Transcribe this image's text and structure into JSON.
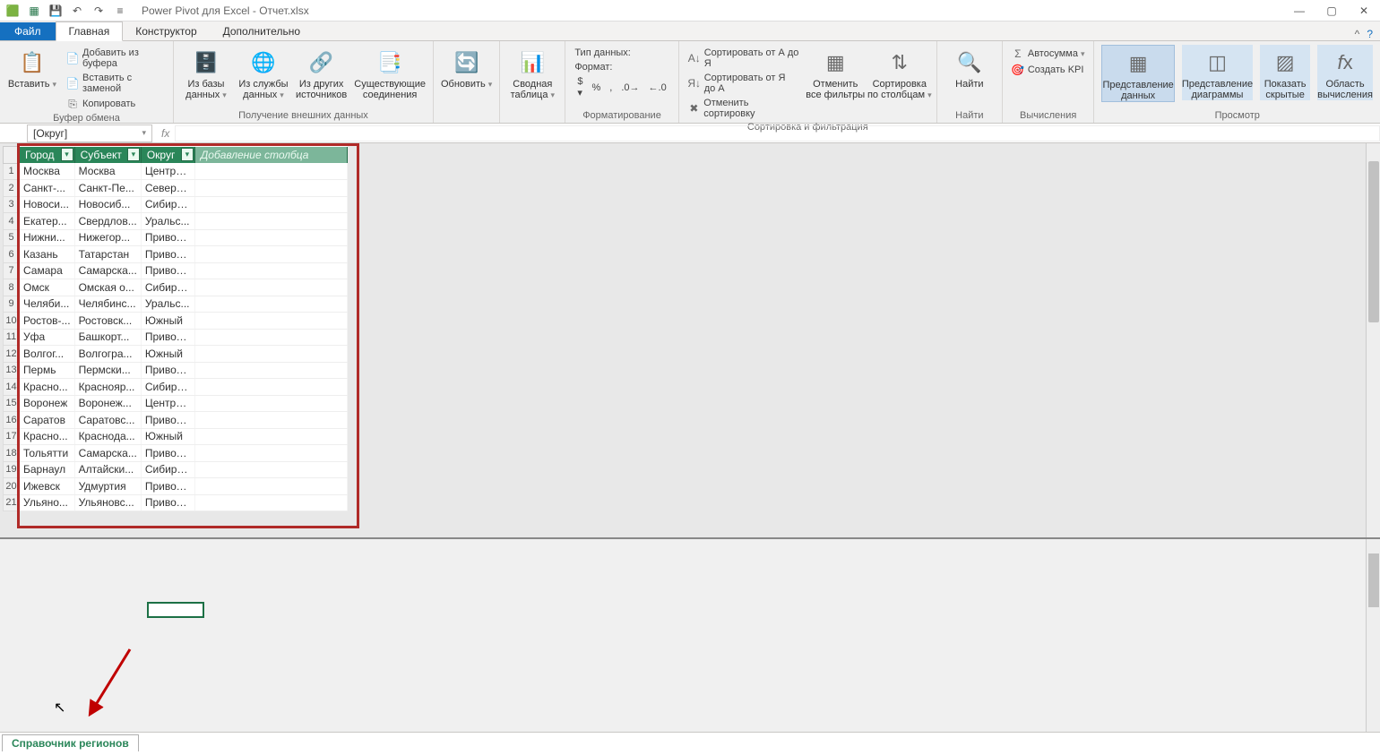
{
  "title": "Power Pivot для Excel - Отчет.xlsx",
  "tabs": {
    "file": "Файл",
    "home": "Главная",
    "design": "Конструктор",
    "advanced": "Дополнительно"
  },
  "ribbon": {
    "clipboard": {
      "paste": "Вставить",
      "paste_buf": "Добавить из буфера",
      "paste_replace": "Вставить с заменой",
      "copy": "Копировать",
      "group": "Буфер обмена"
    },
    "get_data": {
      "db": "Из базы\nданных",
      "service": "Из службы\nданных",
      "other": "Из других\nисточников",
      "existing": "Существующие\nсоединения",
      "group": "Получение внешних данных"
    },
    "refresh": "Обновить",
    "pivot": "Сводная\nтаблица",
    "format": {
      "type_lbl": "Тип данных:",
      "format_lbl": "Формат:",
      "group": "Форматирование"
    },
    "sort": {
      "az": "Сортировать от А до Я",
      "za": "Сортировать от Я до А",
      "clear_sort": "Отменить сортировку",
      "clear_filter": "Отменить\nвсе фильтры",
      "by_col": "Сортировка\nпо столбцам",
      "group": "Сортировка и фильтрация"
    },
    "find": {
      "find": "Найти",
      "group": "Найти"
    },
    "calc": {
      "autosum": "Автосумма",
      "kpi": "Создать KPI",
      "group": "Вычисления"
    },
    "view": {
      "data": "Представление\nданных",
      "diagram": "Представление\nдиаграммы",
      "hidden": "Показать\nскрытые",
      "calc_area": "Область\nвычисления",
      "group": "Просмотр"
    }
  },
  "namebox": "[Округ]",
  "columns": {
    "c1": "Город",
    "c2": "Субъект",
    "c3": "Округ",
    "add": "Добавление столбца"
  },
  "rows": [
    {
      "n": "1",
      "c1": "Москва",
      "c2": "Москва",
      "c3": "Центра..."
    },
    {
      "n": "2",
      "c1": "Санкт-...",
      "c2": "Санкт-Пе...",
      "c3": "Северо..."
    },
    {
      "n": "3",
      "c1": "Новоси...",
      "c2": "Новосиб...",
      "c3": "Сибирс..."
    },
    {
      "n": "4",
      "c1": "Екатер...",
      "c2": "Свердлов...",
      "c3": "Уральс..."
    },
    {
      "n": "5",
      "c1": "Нижни...",
      "c2": "Нижегор...",
      "c3": "Привол..."
    },
    {
      "n": "6",
      "c1": "Казань",
      "c2": "Татарстан",
      "c3": "Привол..."
    },
    {
      "n": "7",
      "c1": "Самара",
      "c2": "Самарска...",
      "c3": "Привол..."
    },
    {
      "n": "8",
      "c1": "Омск",
      "c2": "Омская о...",
      "c3": "Сибирс..."
    },
    {
      "n": "9",
      "c1": "Челяби...",
      "c2": "Челябинс...",
      "c3": "Уральс..."
    },
    {
      "n": "10",
      "c1": "Ростов-...",
      "c2": "Ростовск...",
      "c3": "Южный"
    },
    {
      "n": "11",
      "c1": "Уфа",
      "c2": "Башкорт...",
      "c3": "Привол..."
    },
    {
      "n": "12",
      "c1": "Волгог...",
      "c2": "Волгогра...",
      "c3": "Южный"
    },
    {
      "n": "13",
      "c1": "Пермь",
      "c2": "Пермски...",
      "c3": "Привол..."
    },
    {
      "n": "14",
      "c1": "Красно...",
      "c2": "Краснояр...",
      "c3": "Сибирс..."
    },
    {
      "n": "15",
      "c1": "Воронеж",
      "c2": "Воронеж...",
      "c3": "Центра..."
    },
    {
      "n": "16",
      "c1": "Саратов",
      "c2": "Саратовс...",
      "c3": "Привол..."
    },
    {
      "n": "17",
      "c1": "Красно...",
      "c2": "Краснода...",
      "c3": "Южный"
    },
    {
      "n": "18",
      "c1": "Тольятти",
      "c2": "Самарска...",
      "c3": "Привол..."
    },
    {
      "n": "19",
      "c1": "Барнаул",
      "c2": "Алтайски...",
      "c3": "Сибирс..."
    },
    {
      "n": "20",
      "c1": "Ижевск",
      "c2": "Удмуртия",
      "c3": "Привол..."
    },
    {
      "n": "21",
      "c1": "Ульяно...",
      "c2": "Ульяновс...",
      "c3": "Привол..."
    }
  ],
  "sheet_tab": "Справочник регионов"
}
